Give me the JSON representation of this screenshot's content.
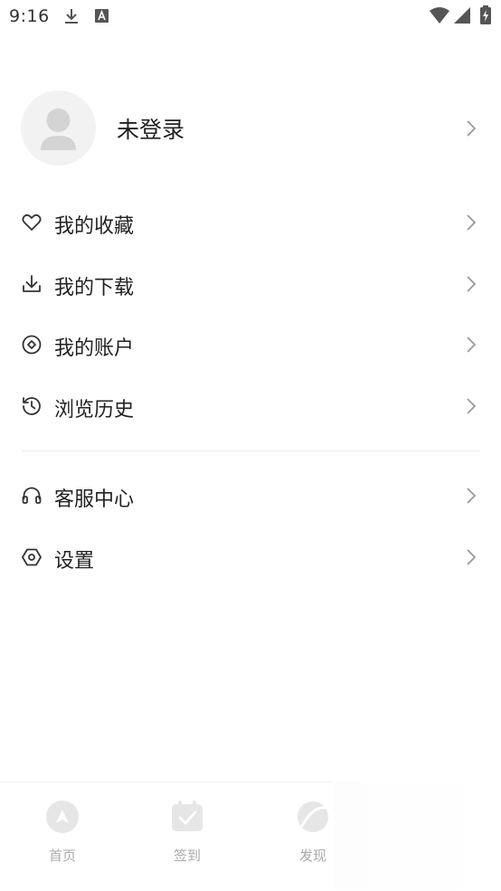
{
  "status_bar": {
    "time": "9:16"
  },
  "profile": {
    "name": "未登录"
  },
  "menu_group_1": [
    {
      "label": "我的收藏",
      "icon": "heart-icon"
    },
    {
      "label": "我的下载",
      "icon": "download-icon"
    },
    {
      "label": "我的账户",
      "icon": "account-icon"
    },
    {
      "label": "浏览历史",
      "icon": "history-icon"
    }
  ],
  "menu_group_2": [
    {
      "label": "客服中心",
      "icon": "headset-icon"
    },
    {
      "label": "设置",
      "icon": "settings-icon"
    }
  ],
  "bottom_nav": [
    {
      "label": "首页",
      "icon": "home-icon"
    },
    {
      "label": "签到",
      "icon": "checkin-icon"
    },
    {
      "label": "发现",
      "icon": "discover-icon"
    }
  ],
  "colors": {
    "text": "#222222",
    "icon": "#333333",
    "chevron": "#9a9a9a",
    "avatar_bg": "#f2f2f2",
    "avatar_fg": "#d4d4d4",
    "nav_faded": "#e6e6e6"
  }
}
